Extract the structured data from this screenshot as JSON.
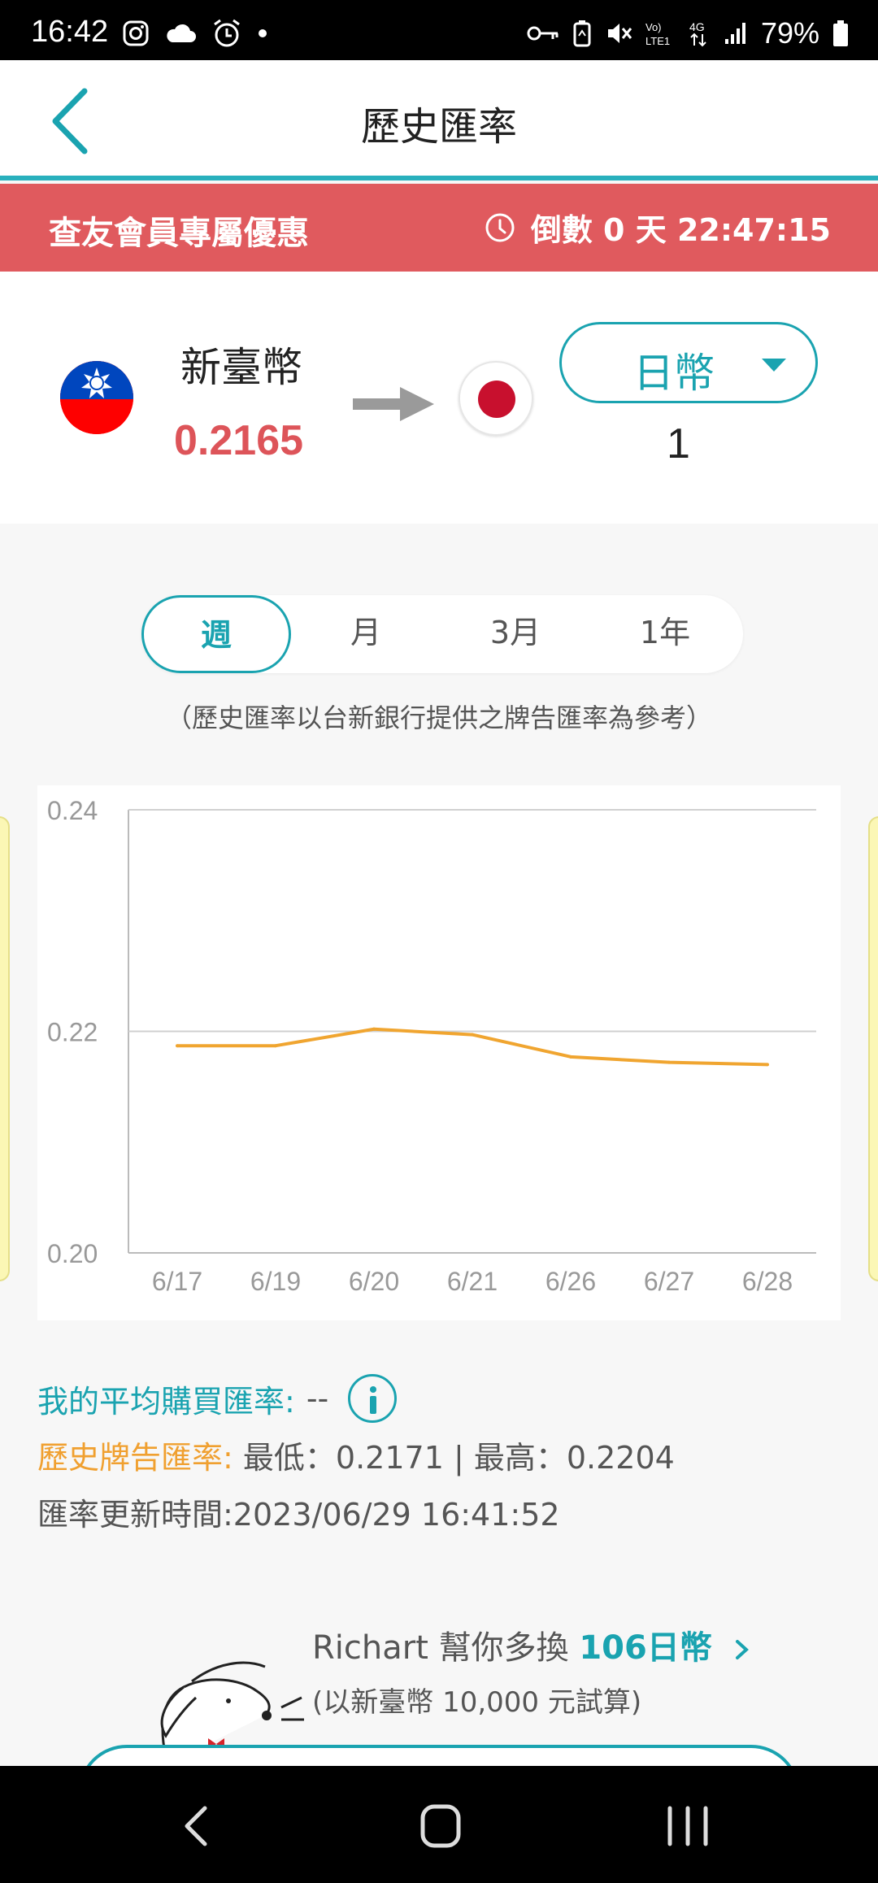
{
  "status_bar": {
    "time": "16:42",
    "battery": "79%",
    "icons": [
      "instagram-icon",
      "cloud-icon",
      "alarm-icon",
      "dot-icon",
      "vpn-key-icon",
      "battery-saver-icon",
      "mute-icon",
      "volte-icon",
      "4g-icon",
      "signal-icon",
      "battery-icon"
    ]
  },
  "header": {
    "title": "歷史匯率",
    "back_icon": "chevron-left-icon"
  },
  "promo_banner": {
    "title": "查友會員專屬優惠",
    "countdown": "倒數 0 天 22:47:15"
  },
  "converter": {
    "from_currency": "新臺幣",
    "from_value": "0.2165",
    "to_currency": "日幣",
    "to_value": "1"
  },
  "tabs": [
    {
      "label": "週",
      "active": true
    },
    {
      "label": "月",
      "active": false
    },
    {
      "label": "3月",
      "active": false
    },
    {
      "label": "1年",
      "active": false
    }
  ],
  "note": "（歷史匯率以台新銀行提供之牌告匯率為參考）",
  "chart_data": {
    "type": "line",
    "categories": [
      "6/17",
      "6/19",
      "6/20",
      "6/21",
      "6/26",
      "6/27",
      "6/28"
    ],
    "values": [
      0.2187,
      0.2187,
      0.2202,
      0.2197,
      0.2177,
      0.2172,
      0.217
    ],
    "ylim": [
      0.2,
      0.24
    ],
    "yticks": [
      "0.24",
      "0.22",
      "0.20"
    ],
    "grid": true,
    "line_color": "#f0a530"
  },
  "info": {
    "avg_label": "我的平均購買匯率:",
    "avg_value": "--",
    "hist_label": "歷史牌告匯率:",
    "hist_value": "最低：0.2171 | 最高：0.2204",
    "updated": "匯率更新時間:2023/06/29 16:41:52"
  },
  "richart_promo": {
    "prefix": "Richart 幫你多換 ",
    "highlight": "106日幣",
    "sub": "(以新臺幣 10,000 元試算)"
  },
  "colors": {
    "accent": "#1aa3b0",
    "promo_red": "#e05a5e",
    "rate_red": "#dd5459",
    "orange": "#f0a530"
  }
}
